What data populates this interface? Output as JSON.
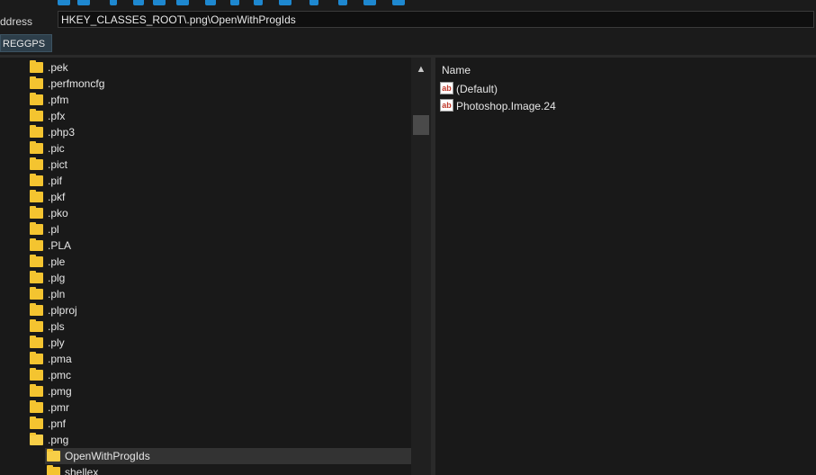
{
  "toolbar": {
    "icons": [
      "back-icon",
      "registry-icon",
      "new-key-icon",
      "cut-icon",
      "copy-icon",
      "paste-icon",
      "bookmark-icon",
      "undo-icon",
      "redo-icon",
      "find-icon",
      "prev-icon",
      "next-icon",
      "settings-icon",
      "help-icon"
    ]
  },
  "address": {
    "label": "ddress",
    "value": "HKEY_CLASSES_ROOT\\.png\\OpenWithProgIds"
  },
  "favorites": {
    "button": "REGGPS"
  },
  "tree": {
    "items": [
      {
        "label": ".pek",
        "depth": 0,
        "selected": false,
        "open": false
      },
      {
        "label": ".perfmoncfg",
        "depth": 0,
        "selected": false,
        "open": false
      },
      {
        "label": ".pfm",
        "depth": 0,
        "selected": false,
        "open": false
      },
      {
        "label": ".pfx",
        "depth": 0,
        "selected": false,
        "open": false
      },
      {
        "label": ".php3",
        "depth": 0,
        "selected": false,
        "open": false
      },
      {
        "label": ".pic",
        "depth": 0,
        "selected": false,
        "open": false
      },
      {
        "label": ".pict",
        "depth": 0,
        "selected": false,
        "open": false
      },
      {
        "label": ".pif",
        "depth": 0,
        "selected": false,
        "open": false
      },
      {
        "label": ".pkf",
        "depth": 0,
        "selected": false,
        "open": false
      },
      {
        "label": ".pko",
        "depth": 0,
        "selected": false,
        "open": false
      },
      {
        "label": ".pl",
        "depth": 0,
        "selected": false,
        "open": false
      },
      {
        "label": ".PLA",
        "depth": 0,
        "selected": false,
        "open": false
      },
      {
        "label": ".ple",
        "depth": 0,
        "selected": false,
        "open": false
      },
      {
        "label": ".plg",
        "depth": 0,
        "selected": false,
        "open": false
      },
      {
        "label": ".pln",
        "depth": 0,
        "selected": false,
        "open": false
      },
      {
        "label": ".plproj",
        "depth": 0,
        "selected": false,
        "open": false
      },
      {
        "label": ".pls",
        "depth": 0,
        "selected": false,
        "open": false
      },
      {
        "label": ".ply",
        "depth": 0,
        "selected": false,
        "open": false
      },
      {
        "label": ".pma",
        "depth": 0,
        "selected": false,
        "open": false
      },
      {
        "label": ".pmc",
        "depth": 0,
        "selected": false,
        "open": false
      },
      {
        "label": ".pmg",
        "depth": 0,
        "selected": false,
        "open": false
      },
      {
        "label": ".pmr",
        "depth": 0,
        "selected": false,
        "open": false
      },
      {
        "label": ".pnf",
        "depth": 0,
        "selected": false,
        "open": false
      },
      {
        "label": ".png",
        "depth": 0,
        "selected": false,
        "open": true
      },
      {
        "label": "OpenWithProgIds",
        "depth": 1,
        "selected": true,
        "open": true
      },
      {
        "label": "shellex",
        "depth": 1,
        "selected": false,
        "open": false
      }
    ]
  },
  "list": {
    "column_name": "Name",
    "values": [
      {
        "icon": "string-value-icon",
        "badge": "ab",
        "name": "(Default)"
      },
      {
        "icon": "string-value-icon",
        "badge": "ab",
        "name": "Photoshop.Image.24"
      }
    ]
  },
  "colors": {
    "accent": "#1e88d0",
    "folder": "#f4c430",
    "selection": "#333333",
    "background": "#191919"
  }
}
